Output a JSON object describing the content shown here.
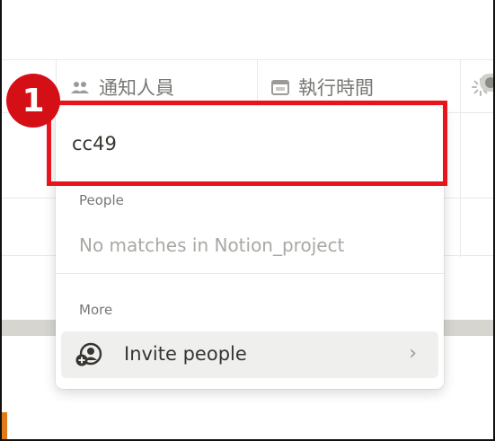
{
  "table": {
    "columns": [
      {
        "label": "通知人員",
        "icon": "people-icon"
      },
      {
        "label": "執行時間",
        "icon": "calendar-icon"
      },
      {
        "label": "",
        "icon": "loading-icon"
      }
    ]
  },
  "popup": {
    "search": {
      "value": "cc49"
    },
    "people_section": {
      "label": "People",
      "empty_text": "No matches in Notion_project"
    },
    "more_section": {
      "label": "More",
      "items": [
        {
          "label": "Invite people",
          "icon": "invite-people-icon"
        }
      ]
    }
  },
  "annotation": {
    "step_number": "1",
    "color": "#e8141b"
  },
  "colors": {
    "accent_orange": "#e07b17",
    "band_gray": "#d6d5d0"
  }
}
